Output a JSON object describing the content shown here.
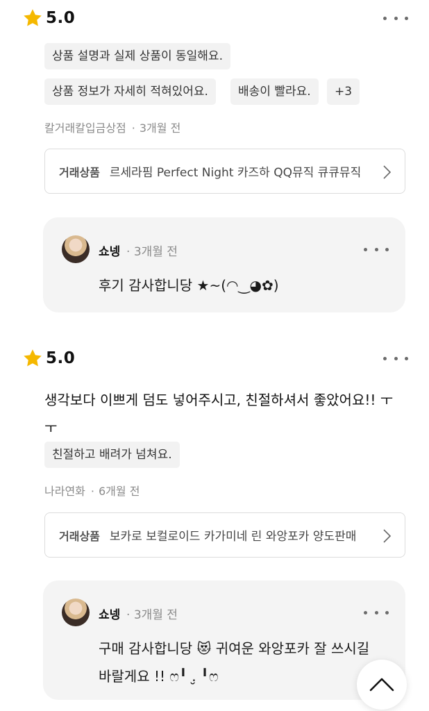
{
  "reviews": [
    {
      "rating": "5.0",
      "body": "",
      "tags": [
        "상품 설명과 실제 상품이 동일해요.",
        "상품 정보가 자세히 적혀있어요.",
        "배송이 빨라요.",
        "+3"
      ],
      "reviewer": "칼거래칼입금상점",
      "time": "3개월 전",
      "trade_label": "거래상품",
      "trade_product": "르세라핌 Perfect Night 카즈하 QQ뮤직 큐큐뮤직",
      "reply": {
        "name": "쇼넹",
        "time": "3개월 전",
        "text": "후기 감사합니당 ★~(◠‿◕✿)"
      }
    },
    {
      "rating": "5.0",
      "body": "생각보다 이쁘게 덤도 넣어주시고, 친절하셔서 좋았어요!! ㅜㅜ",
      "tags": [
        "친절하고 배려가 넘쳐요."
      ],
      "reviewer": "나라연화",
      "time": "6개월 전",
      "trade_label": "거래상품",
      "trade_product": "보카로 보컬로이드 카가미네 린 와앙포카 양도판매",
      "reply": {
        "name": "쇼넹",
        "time": "3개월 전",
        "text": "구매 감사합니당 😻 귀여운 와앙포카 잘 쓰시길 바랄게요 !! ෆ╹ .̮ ╹ෆ"
      }
    }
  ],
  "icons": {
    "star": "star-icon",
    "more": "more-horizontal-icon",
    "chevron": "chevron-right-icon",
    "scroll_top": "chevron-up-icon"
  },
  "colors": {
    "star": "#F5B800",
    "tag_bg": "#F2F2F2",
    "reply_bg": "#F4F4F4",
    "meta_text": "#8A8A8A"
  }
}
